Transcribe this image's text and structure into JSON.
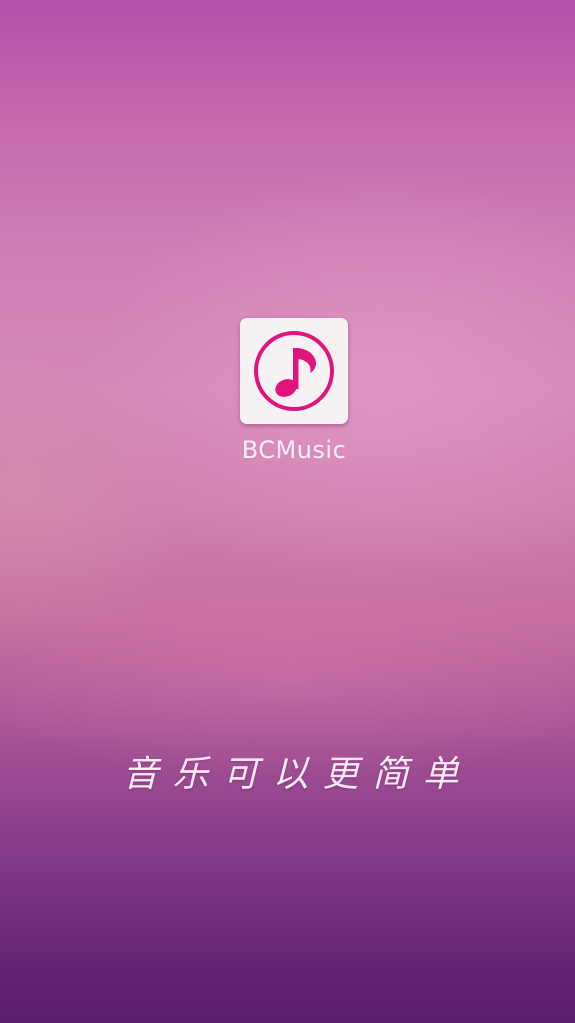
{
  "splash": {
    "app_name": "BCMusic",
    "slogan": "音乐可以更简单",
    "icon": "music-note-icon",
    "colors": {
      "accent": "#e0137f",
      "icon_background": "#f6f1f3",
      "text": "#fbeef8"
    }
  }
}
